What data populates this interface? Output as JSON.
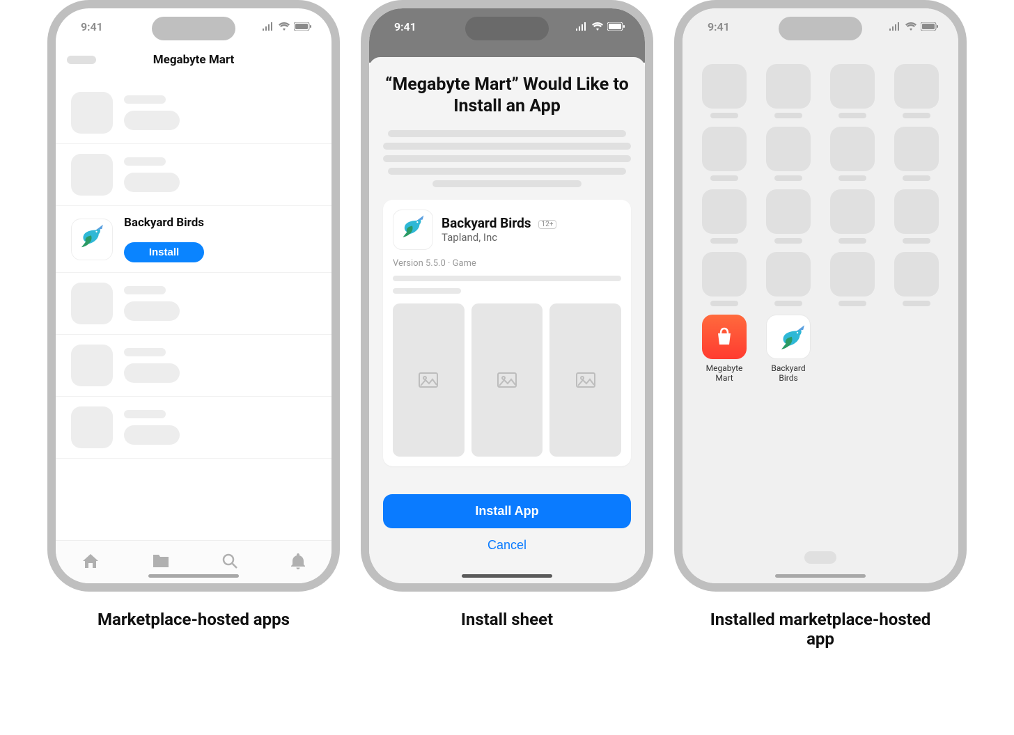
{
  "status": {
    "time": "9:41"
  },
  "screens": {
    "marketplace": {
      "title": "Megabyte Mart",
      "featured_app": {
        "name": "Backyard Birds",
        "install_label": "Install"
      },
      "caption": "Marketplace-hosted apps"
    },
    "install_sheet": {
      "title": "“Megabyte Mart” Would Like to Install an App",
      "app": {
        "name": "Backyard Birds",
        "age_rating": "12+",
        "publisher": "Tapland, Inc",
        "version_line": "Version 5.5.0 · Game"
      },
      "primary_label": "Install App",
      "cancel_label": "Cancel",
      "caption": "Install sheet"
    },
    "home": {
      "apps": {
        "megabyte_mart": "Megabyte Mart",
        "backyard_birds": "Backyard Birds"
      },
      "caption": "Installed marketplace-hosted app"
    }
  }
}
